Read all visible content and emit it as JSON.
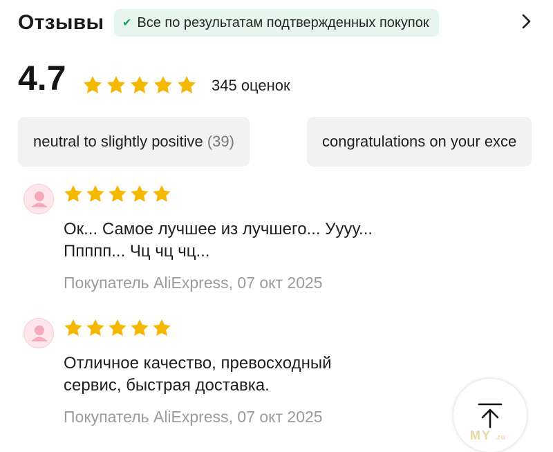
{
  "header": {
    "title": "Отзывы",
    "verified_label": "Все по результатам подтвержденных покупок"
  },
  "summary": {
    "average": "4.7",
    "count_label": "345 оценок",
    "stars_filled": 5,
    "star_color": "#f5b800"
  },
  "chips": [
    {
      "label": "neutral to slightly positive",
      "count": "(39)"
    },
    {
      "label": "congratulations on your exce",
      "count": ""
    }
  ],
  "reviews": [
    {
      "stars": 5,
      "text_lines": [
        "Ок... Самое лучшее из лучшего... Уууу...",
        "Ппппп... Чц чц чц..."
      ],
      "author_date": "Покупатель AliExpress, 07 окт 2025"
    },
    {
      "stars": 5,
      "text_lines": [
        "Отличное качество, превосходный",
        "сервис, быстрая доставка."
      ],
      "author_date": "Покупатель AliExpress, 07 окт 2025"
    }
  ],
  "watermark": {
    "text": "MY",
    "suffix": ".ru"
  },
  "icons": {
    "verified": "check-icon",
    "more": "chevron-right-icon",
    "star": "star-icon",
    "avatar": "user-avatar-icon",
    "scroll_top": "arrow-up-to-top-icon"
  },
  "colors": {
    "badge_bg": "#e6f6ee",
    "check": "#1a9c5a",
    "chip_bg": "#f2f2f2",
    "meta_text": "#9b9b9b"
  }
}
